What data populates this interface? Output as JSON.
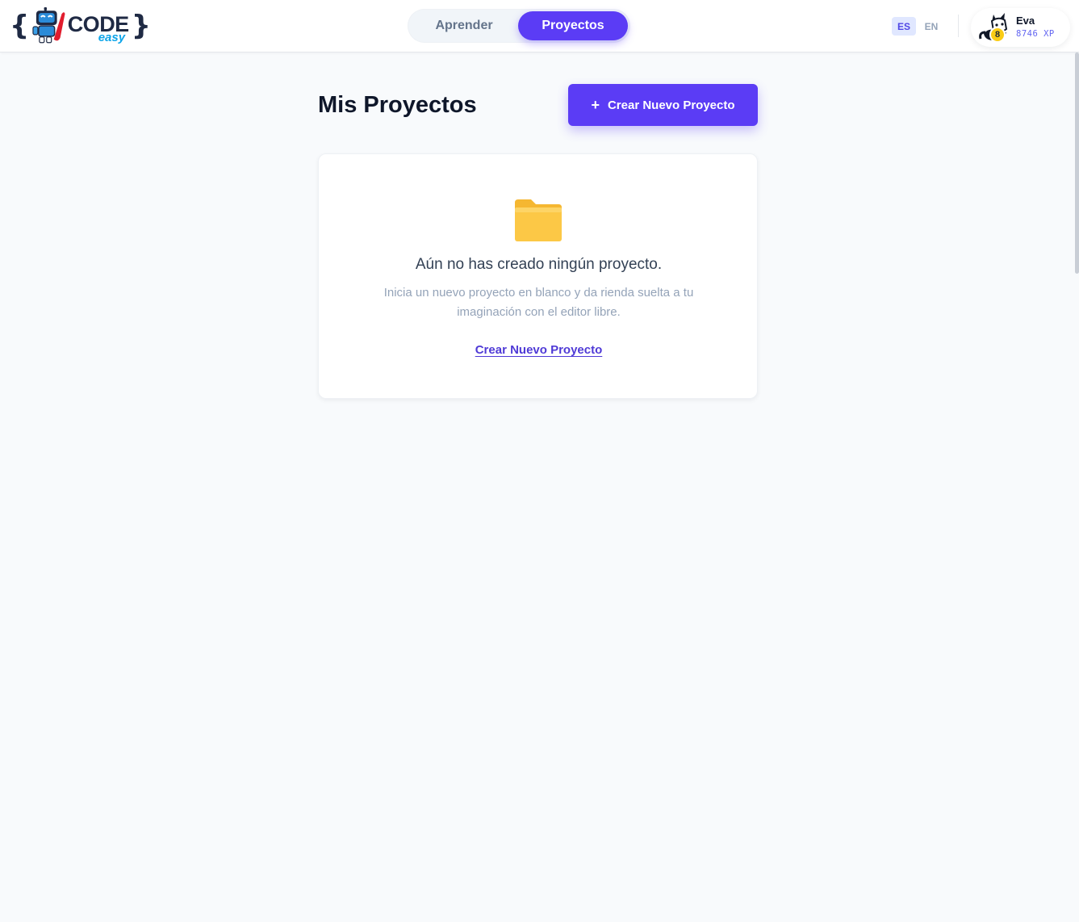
{
  "brand": {
    "name_primary": "CODE",
    "name_secondary": "easy",
    "brace_open": "{",
    "brace_close": "}",
    "logo_icon": "robot-mascot-icon"
  },
  "nav": {
    "tabs": [
      {
        "label": "Aprender",
        "active": false
      },
      {
        "label": "Proyectos",
        "active": true
      }
    ]
  },
  "language": {
    "options": [
      {
        "label": "ES",
        "active": true
      },
      {
        "label": "EN",
        "active": false
      }
    ]
  },
  "user": {
    "name": "Eva",
    "xp": "8746 XP",
    "level": "8",
    "avatar_icon": "fox-avatar-icon"
  },
  "page": {
    "title": "Mis Proyectos",
    "create_button_icon": "+",
    "create_button_label": "Crear Nuevo Proyecto"
  },
  "empty_state": {
    "icon": "folder-icon",
    "title": "Aún no has creado ningún proyecto.",
    "description": "Inicia un nuevo proyecto en blanco y da rienda suelta a tu imaginación con el editor libre.",
    "link_label": "Crear Nuevo Proyecto"
  },
  "colors": {
    "accent": "#5b3cf5",
    "background": "#f8fafc",
    "folder": "#fcc846",
    "xp": "#6366f1"
  }
}
